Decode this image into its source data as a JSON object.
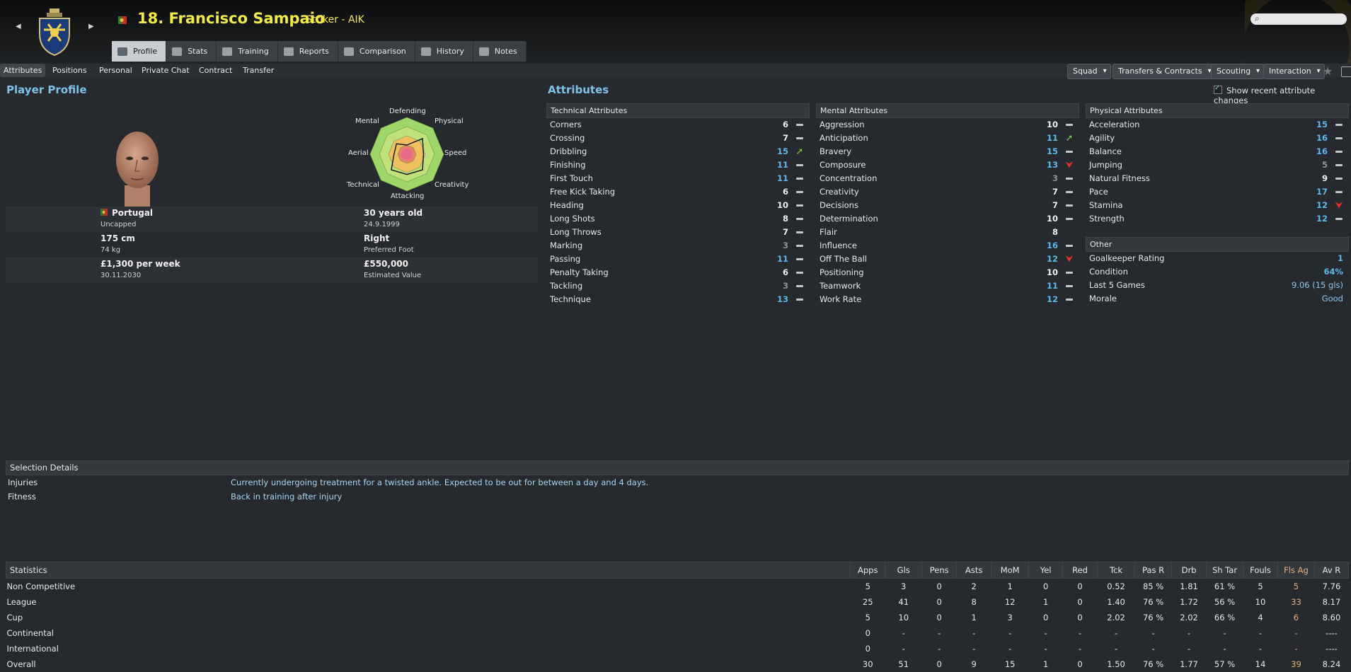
{
  "header": {
    "title_number_name": "18. Francisco Sampaio",
    "subtitle": "Striker - AIK",
    "search_placeholder": ""
  },
  "tabs": [
    "Profile",
    "Stats",
    "Training",
    "Reports",
    "Comparison",
    "History",
    "Notes"
  ],
  "subnav": [
    "Attributes",
    "Positions",
    "Personal",
    "Private Chat",
    "Contract",
    "Transfer"
  ],
  "toolbar": [
    "Squad",
    "Transfers & Contracts",
    "Scouting",
    "Interaction"
  ],
  "profile": {
    "section_title": "Player Profile",
    "nationality": "Portugal",
    "caps": "Uncapped",
    "age": "30 years old",
    "dob": "24.9.1999",
    "height": "175 cm",
    "weight": "74 kg",
    "foot": "Right",
    "foot_label": "Preferred Foot",
    "wage": "£1,300 per week",
    "contract_end": "30.11.2030",
    "value": "£550,000",
    "value_label": "Estimated Value",
    "radar_labels": [
      "Defending",
      "Physical",
      "Speed",
      "Creativity",
      "Attacking",
      "Technical",
      "Aerial",
      "Mental"
    ],
    "radar_values": [
      0.25,
      0.6,
      0.45,
      0.6,
      0.55,
      0.6,
      0.35,
      0.4
    ]
  },
  "attributes": {
    "section_title": "Attributes",
    "show_changes_label": "Show recent attribute changes",
    "technical": {
      "title": "Technical Attributes",
      "rows": [
        {
          "name": "Corners",
          "value": "6",
          "trend": "flat",
          "color": "white"
        },
        {
          "name": "Crossing",
          "value": "7",
          "trend": "flat",
          "color": "white"
        },
        {
          "name": "Dribbling",
          "value": "15",
          "trend": "up",
          "color": "blue"
        },
        {
          "name": "Finishing",
          "value": "11",
          "trend": "flat",
          "color": "blue"
        },
        {
          "name": "First Touch",
          "value": "11",
          "trend": "flat",
          "color": "blue"
        },
        {
          "name": "Free Kick Taking",
          "value": "6",
          "trend": "flat",
          "color": "white"
        },
        {
          "name": "Heading",
          "value": "10",
          "trend": "flat",
          "color": "white"
        },
        {
          "name": "Long Shots",
          "value": "8",
          "trend": "flat",
          "color": "white"
        },
        {
          "name": "Long Throws",
          "value": "7",
          "trend": "flat",
          "color": "white"
        },
        {
          "name": "Marking",
          "value": "3",
          "trend": "flat",
          "color": "grey"
        },
        {
          "name": "Passing",
          "value": "11",
          "trend": "flat",
          "color": "blue"
        },
        {
          "name": "Penalty Taking",
          "value": "6",
          "trend": "flat",
          "color": "white"
        },
        {
          "name": "Tackling",
          "value": "3",
          "trend": "flat",
          "color": "grey"
        },
        {
          "name": "Technique",
          "value": "13",
          "trend": "flat",
          "color": "blue"
        }
      ]
    },
    "mental": {
      "title": "Mental Attributes",
      "rows": [
        {
          "name": "Aggression",
          "value": "10",
          "trend": "flat",
          "color": "white"
        },
        {
          "name": "Anticipation",
          "value": "11",
          "trend": "up",
          "color": "blue"
        },
        {
          "name": "Bravery",
          "value": "15",
          "trend": "flat",
          "color": "blue"
        },
        {
          "name": "Composure",
          "value": "13",
          "trend": "down",
          "color": "blue"
        },
        {
          "name": "Concentration",
          "value": "3",
          "trend": "flat",
          "color": "grey"
        },
        {
          "name": "Creativity",
          "value": "7",
          "trend": "flat",
          "color": "white"
        },
        {
          "name": "Decisions",
          "value": "7",
          "trend": "flat",
          "color": "white"
        },
        {
          "name": "Determination",
          "value": "10",
          "trend": "flat",
          "color": "white"
        },
        {
          "name": "Flair",
          "value": "8",
          "trend": "none",
          "color": "white"
        },
        {
          "name": "Influence",
          "value": "16",
          "trend": "flat",
          "color": "blue"
        },
        {
          "name": "Off The Ball",
          "value": "12",
          "trend": "down",
          "color": "blue"
        },
        {
          "name": "Positioning",
          "value": "10",
          "trend": "flat",
          "color": "white"
        },
        {
          "name": "Teamwork",
          "value": "11",
          "trend": "flat",
          "color": "blue"
        },
        {
          "name": "Work Rate",
          "value": "12",
          "trend": "flat",
          "color": "blue"
        }
      ]
    },
    "physical": {
      "title": "Physical Attributes",
      "rows": [
        {
          "name": "Acceleration",
          "value": "15",
          "trend": "flat",
          "color": "blue"
        },
        {
          "name": "Agility",
          "value": "16",
          "trend": "flat",
          "color": "blue"
        },
        {
          "name": "Balance",
          "value": "16",
          "trend": "flat",
          "color": "blue"
        },
        {
          "name": "Jumping",
          "value": "5",
          "trend": "flat",
          "color": "grey"
        },
        {
          "name": "Natural Fitness",
          "value": "9",
          "trend": "flat",
          "color": "white"
        },
        {
          "name": "Pace",
          "value": "17",
          "trend": "flat",
          "color": "blue"
        },
        {
          "name": "Stamina",
          "value": "12",
          "trend": "down",
          "color": "blue"
        },
        {
          "name": "Strength",
          "value": "12",
          "trend": "flat",
          "color": "blue"
        }
      ]
    },
    "other": {
      "title": "Other",
      "rows": [
        {
          "name": "Goalkeeper Rating",
          "value": "1"
        },
        {
          "name": "Condition",
          "value": "64%"
        },
        {
          "name": "Last 5 Games",
          "value": "9.06 (15 gls)"
        },
        {
          "name": "Morale",
          "value": "Good"
        }
      ]
    }
  },
  "selection": {
    "title": "Selection Details",
    "rows": [
      {
        "key": "Injuries",
        "value": "Currently undergoing treatment for a twisted ankle. Expected to be out for between a day and 4 days."
      },
      {
        "key": "Fitness",
        "value": "Back in training after injury"
      }
    ]
  },
  "statistics": {
    "title": "Statistics",
    "columns": [
      "Apps",
      "Gls",
      "Pens",
      "Asts",
      "MoM",
      "Yel",
      "Red",
      "Tck",
      "Pas R",
      "Drb",
      "Sh Tar",
      "Fouls",
      "Fls Ag",
      "Av R"
    ],
    "rows": [
      {
        "label": "Non Competitive",
        "cells": [
          "5",
          "3",
          "0",
          "2",
          "1",
          "0",
          "0",
          "0.52",
          "85 %",
          "1.81",
          "61 %",
          "5",
          "5",
          "7.76"
        ]
      },
      {
        "label": "League",
        "cells": [
          "25",
          "41",
          "0",
          "8",
          "12",
          "1",
          "0",
          "1.40",
          "76 %",
          "1.72",
          "56 %",
          "10",
          "33",
          "8.17"
        ]
      },
      {
        "label": "Cup",
        "cells": [
          "5",
          "10",
          "0",
          "1",
          "3",
          "0",
          "0",
          "2.02",
          "76 %",
          "2.02",
          "66 %",
          "4",
          "6",
          "8.60"
        ]
      },
      {
        "label": "Continental",
        "cells": [
          "0",
          "-",
          "-",
          "-",
          "-",
          "-",
          "-",
          "-",
          "-",
          "-",
          "-",
          "-",
          "-",
          "----"
        ]
      },
      {
        "label": "International",
        "cells": [
          "0",
          "-",
          "-",
          "-",
          "-",
          "-",
          "-",
          "-",
          "-",
          "-",
          "-",
          "-",
          "-",
          "----"
        ]
      },
      {
        "label": "Overall",
        "cells": [
          "30",
          "51",
          "0",
          "9",
          "15",
          "1",
          "0",
          "1.50",
          "76 %",
          "1.77",
          "57 %",
          "14",
          "39",
          "8.24"
        ]
      }
    ]
  },
  "colors": {
    "accent": "#7ec2ea",
    "name_yellow": "#f2e94a",
    "value_blue": "#5fb8ea",
    "up": "#7cc84a",
    "down": "#e8302a"
  }
}
